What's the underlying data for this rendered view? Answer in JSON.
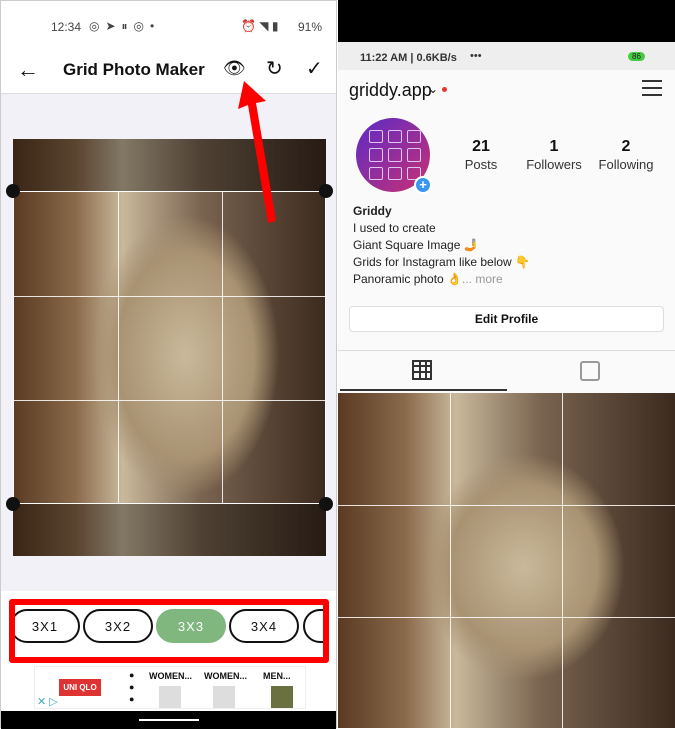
{
  "left": {
    "status": {
      "time": "12:34",
      "battery": "91%"
    },
    "toolbar": {
      "title": "Grid Photo Maker"
    },
    "grid_options": [
      "3X1",
      "3X2",
      "3X3",
      "3X4"
    ],
    "selected_option": "3X3",
    "ad": {
      "brand": "UNI QLO",
      "items": [
        "WOMEN...",
        "WOMEN...",
        "MEN..."
      ]
    },
    "colors": {
      "accent": "#7fb77e",
      "highlight": "#ff0000"
    }
  },
  "right": {
    "status": {
      "time": "11:22 AM | 0.6KB/s",
      "dots": "•••",
      "battery": "86"
    },
    "header": {
      "username": "griddy.app"
    },
    "stats": [
      {
        "value": "21",
        "label": "Posts"
      },
      {
        "value": "1",
        "label": "Followers"
      },
      {
        "value": "2",
        "label": "Following"
      }
    ],
    "bio": {
      "name": "Griddy",
      "lines": [
        "I used to create",
        "Giant Square Image 🤳",
        "Grids for Instagram like below 👇",
        "Panoramic photo 👌"
      ],
      "more": "... more"
    },
    "edit_profile": "Edit Profile"
  }
}
